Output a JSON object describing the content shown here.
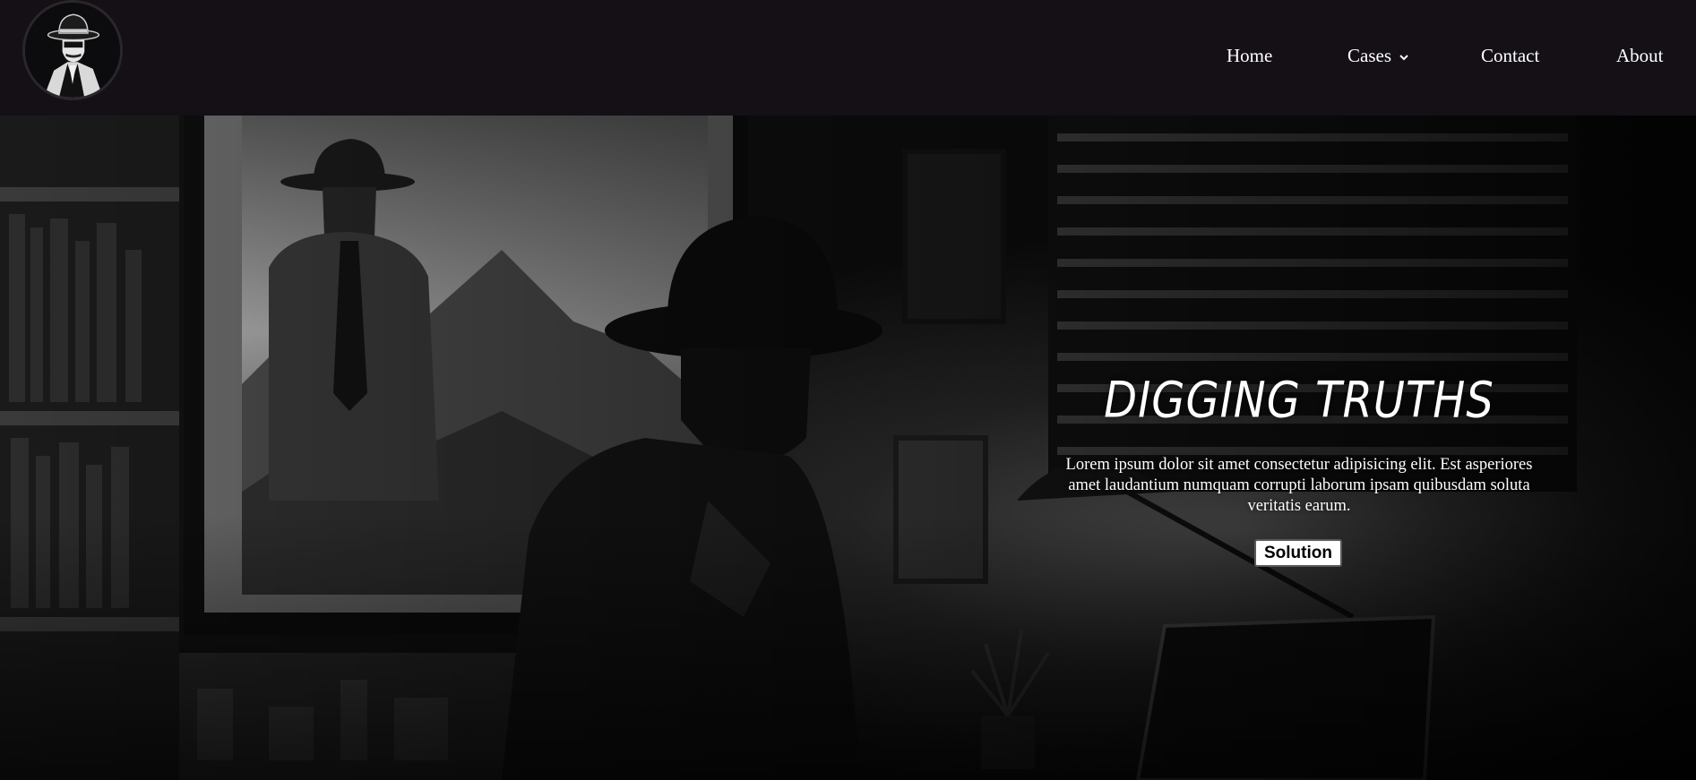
{
  "nav": {
    "logo_icon": "detective-logo-icon",
    "items": [
      {
        "label": "Home"
      },
      {
        "label": "Cases",
        "icon": "chevron-down-icon"
      },
      {
        "label": "Contact"
      },
      {
        "label": "About"
      }
    ]
  },
  "hero": {
    "title": "DIGGING TRUTHS",
    "description": "Lorem ipsum dolor sit amet consectetur adipisicing elit. Est asperiores amet laudantium numquam corrupti laborum ipsam quibusdam soluta veritatis earum.",
    "button_label": "Solution"
  },
  "colors": {
    "nav_background": "#141016",
    "text": "#ffffff",
    "button_background": "#ffffff",
    "button_text": "#000000"
  }
}
